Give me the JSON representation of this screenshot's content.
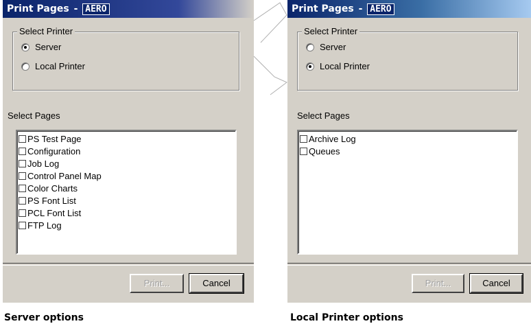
{
  "dialogs": [
    {
      "title": "Print Pages",
      "title_separator": "-",
      "server_name": "AERO",
      "select_printer_label": "Select Printer",
      "radios": [
        {
          "label": "Server",
          "checked": true
        },
        {
          "label": "Local Printer",
          "checked": false
        }
      ],
      "select_pages_label": "Select Pages",
      "pages": [
        "PS Test Page",
        "Configuration",
        "Job Log",
        "Control Panel Map",
        "Color Charts",
        "PS Font List",
        "PCL Font List",
        "FTP Log"
      ],
      "print_button": "Print...",
      "cancel_button": "Cancel",
      "caption": "Server options"
    },
    {
      "title": "Print Pages",
      "title_separator": "-",
      "server_name": "AERO",
      "select_printer_label": "Select Printer",
      "radios": [
        {
          "label": "Server",
          "checked": false
        },
        {
          "label": "Local Printer",
          "checked": true
        }
      ],
      "select_pages_label": "Select Pages",
      "pages": [
        "Archive Log",
        "Queues"
      ],
      "print_button": "Print...",
      "cancel_button": "Cancel",
      "caption": "Local Printer options"
    }
  ],
  "colors": {
    "dialog_bg": "#d4d0c8",
    "titlebar_dark": "#0a246a",
    "titlebar_light": "#a6caf0"
  }
}
